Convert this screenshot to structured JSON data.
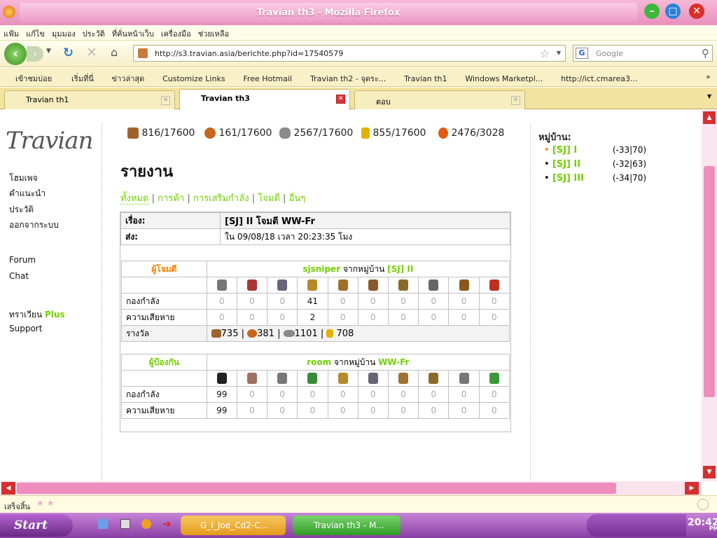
{
  "window": {
    "title": "Travian th3 - Mozilla Firefox"
  },
  "menu": [
    "แฟ้ม",
    "แก้ไข",
    "มุมมอง",
    "ประวัติ",
    "ที่คั่นหน้าเว็บ",
    "เครื่องมือ",
    "ช่วยเหลือ"
  ],
  "nav": {
    "url": "http://s3.travian.asia/berichte.php?id=17540579",
    "search_placeholder": "Google"
  },
  "bookmarks": [
    "เข้าชมบ่อย",
    "เริ่มที่นี่",
    "ข่าวล่าสุด",
    "Customize Links",
    "Free Hotmail",
    "Travian th2 - จุดระ...",
    "Travian th1",
    "Windows Marketpl...",
    "http://ict.cmarea3..."
  ],
  "tabs": [
    {
      "label": "Travian th1"
    },
    {
      "label": "Travian th3"
    },
    {
      "label": "ตอบ"
    }
  ],
  "sidebar": {
    "items": [
      "โฮมเพจ",
      "คำแนะนำ",
      "ประวัติ",
      "ออกจากระบบ"
    ],
    "forum": "Forum",
    "chat": "Chat",
    "plus_a": "ทราเวียน",
    "plus_b": "Plus",
    "support": "Support"
  },
  "resources": [
    "816/17600",
    "161/17600",
    "2567/17600",
    "855/17600",
    "2476/3028"
  ],
  "page": {
    "title": "รายงาน",
    "filters": [
      "ทั้งหมด",
      "การค้า",
      "การเสริมกำลัง",
      "โจมตี",
      "อื่นๆ"
    ],
    "sep": "|"
  },
  "report": {
    "subject_label": "เรื่อง:",
    "subject": "[SJ] II โจมตี WW-Fr",
    "sent_label": "ส่ง:",
    "sent": "ใน 09/08/18 เวลา 20:23:35 โมง"
  },
  "attacker": {
    "role": "ผู้โจมตี",
    "player": "sjsniper",
    "from": "จากหมู่บ้าน",
    "village": "[SJ] II",
    "troops_label": "กองกำลัง",
    "troops": [
      "0",
      "0",
      "0",
      "41",
      "0",
      "0",
      "0",
      "0",
      "0",
      "0"
    ],
    "losses_label": "ความเสียหาย",
    "losses": [
      "0",
      "0",
      "0",
      "2",
      "0",
      "0",
      "0",
      "0",
      "0",
      "0"
    ],
    "bounty_label": "รางวัล",
    "bounty": [
      "735",
      "381",
      "1101",
      "708"
    ]
  },
  "defender": {
    "role": "ผู้ป้องกัน",
    "player": "room",
    "from": "จากหมู่บ้าน",
    "village": "WW-Fr",
    "troops_label": "กองกำลัง",
    "troops": [
      "99",
      "0",
      "0",
      "0",
      "0",
      "0",
      "0",
      "0",
      "0",
      "0"
    ],
    "losses_label": "ความเสียหาย",
    "losses": [
      "99",
      "0",
      "0",
      "0",
      "0",
      "0",
      "0",
      "0",
      "0",
      "0"
    ]
  },
  "villages": {
    "title": "หมู่บ้าน:",
    "list": [
      {
        "name": "[SJ] I",
        "coords": "(-33|70)"
      },
      {
        "name": "[SJ] II",
        "coords": "(-32|63)"
      },
      {
        "name": "[SJ] III",
        "coords": "(-34|70)"
      }
    ]
  },
  "status": {
    "text": "เสร็จสิ้น"
  },
  "taskbar": {
    "start": "Start",
    "items": [
      "G_I_Joe_Cd2-C...",
      "Travian th3 - M..."
    ],
    "clock": "20:42",
    "ampm": "PM"
  }
}
